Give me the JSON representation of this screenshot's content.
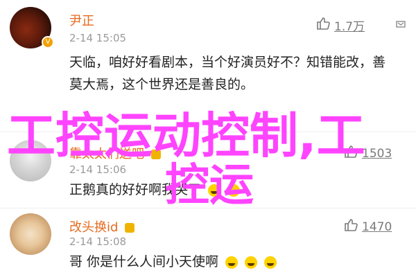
{
  "comments": [
    {
      "username": "尹正",
      "time": "2-14 15:05",
      "likes": "1.7万",
      "text": "天临，咱好好看剧本，当个好演员好不？知错能改，善莫大焉，这个世界还是善良的。"
    },
    {
      "username": "靠太太们送吧",
      "time": "2-14 15:06",
      "likes": "1503",
      "text": "正鹅真的好好啊我哭了"
    },
    {
      "username": "改头换id",
      "time": "2-14 15:08",
      "likes": "1470",
      "text": "哥 你是什么人间小天使啊"
    }
  ],
  "overlay": {
    "line1": "工控运动控制,工",
    "line2": "控运"
  },
  "colors": {
    "username": "#e56b1f",
    "overlay": "#ff44ff"
  }
}
